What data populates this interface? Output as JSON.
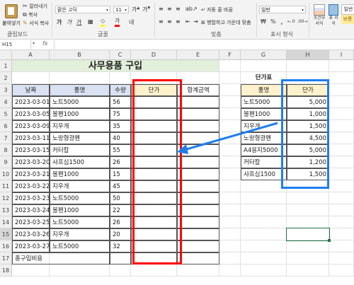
{
  "ribbon": {
    "clipboard": {
      "paste": "붙여넣기",
      "cut": "잘라내기",
      "copy": "복사",
      "format_painter": "서식 복사",
      "group_label": "클립보드"
    },
    "font": {
      "font_name": "맑은 고딕",
      "font_size": "11",
      "bold": "가",
      "italic": "가",
      "underline": "가",
      "group_label": "글꼴"
    },
    "alignment": {
      "wrap_text": "자동 줄 바꿈",
      "merge_center": "병합하고 가운데 맞춤",
      "group_label": "맞춤"
    },
    "number": {
      "format": "일반",
      "currency": "%",
      "comma": ",",
      "group_label": "표시 형식"
    },
    "styles": {
      "conditional": "조건부 서식",
      "as_table": "표 서식",
      "style_label": "일반",
      "style_label2": "보통"
    }
  },
  "formula_bar": {
    "name_box": "H15",
    "fx": "fx",
    "value": ""
  },
  "columns": [
    "A",
    "B",
    "C",
    "D",
    "E",
    "F",
    "G",
    "H",
    "I"
  ],
  "rows": [
    "1",
    "2",
    "3",
    "4",
    "5",
    "6",
    "7",
    "8",
    "9",
    "10",
    "11",
    "12",
    "13",
    "14",
    "15",
    "16",
    "17",
    "18"
  ],
  "title": "사무용품 구입",
  "main_table": {
    "headers": [
      "날짜",
      "품명",
      "수량",
      "단가",
      "합계금액"
    ],
    "rows": [
      [
        "2023-03-01",
        "노트5000",
        "56"
      ],
      [
        "2023-03-05",
        "볼펜1000",
        "75"
      ],
      [
        "2023-03-09",
        "지우개",
        "35"
      ],
      [
        "2023-03-11",
        "노랑형광펜",
        "40"
      ],
      [
        "2023-03-15",
        "커터칼",
        "55"
      ],
      [
        "2023-03-20",
        "샤프심1500",
        "26"
      ],
      [
        "2023-03-21",
        "볼펜1000",
        "15"
      ],
      [
        "2023-03-22",
        "지우개",
        "45"
      ],
      [
        "2023-03-23",
        "노트5000",
        "50"
      ],
      [
        "2023-03-24",
        "볼펜1000",
        "22"
      ],
      [
        "2023-03-25",
        "노트5000",
        "26"
      ],
      [
        "2023-03-26",
        "지우개",
        "20"
      ],
      [
        "2023-03-27",
        "노트5000",
        "32"
      ]
    ],
    "total_label": "총구입비용"
  },
  "price_table": {
    "title": "단가표",
    "headers": [
      "품명",
      "단가"
    ],
    "rows": [
      [
        "노트5000",
        "5,000"
      ],
      [
        "볼펜1000",
        "1,000"
      ],
      [
        "지우개",
        "1,500"
      ],
      [
        "노랑형광펜",
        "4,500"
      ],
      [
        "A4용지5000",
        "5,000"
      ],
      [
        "커터칼",
        "1,200"
      ],
      [
        "샤프심1500",
        "1,500"
      ]
    ]
  },
  "annotations": {
    "red": "#ff0000",
    "blue": "#1e7ef0"
  }
}
